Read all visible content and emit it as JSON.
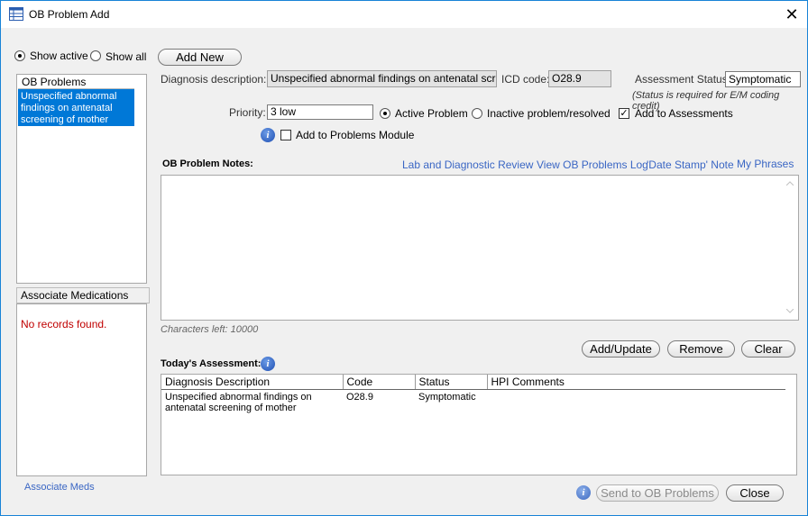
{
  "window": {
    "title": "OB Problem Add",
    "close_glyph": "✕",
    "icon": "table-icon"
  },
  "filter": {
    "show_active": "Show active",
    "show_all": "Show all",
    "selected": "show_active"
  },
  "buttons": {
    "add_new": "Add New",
    "add_update": "Add/Update",
    "remove": "Remove",
    "clear": "Clear",
    "send_to_ob": "Send to OB Problems",
    "close": "Close"
  },
  "ob_problems": {
    "header": "OB Problems",
    "items": [
      {
        "label": "Unspecified abnormal findings on antenatal screening of mother",
        "selected": true
      }
    ]
  },
  "associate_medications": {
    "header": "Associate Medications",
    "empty_text": "No records found.",
    "link": "Associate Meds"
  },
  "form": {
    "diagnosis_label": "Diagnosis description:",
    "diagnosis_value": "Unspecified abnormal findings on antenatal screening of mother",
    "icd_label": "ICD code:",
    "icd_value": "O28.9",
    "assessment_status_label": "Assessment Status:",
    "assessment_status_value": "Symptomatic",
    "status_note": "(Status is required for E/M coding credit)",
    "priority_label": "Priority:",
    "priority_value": "3 low",
    "active_problem": "Active Problem",
    "inactive_problem": "Inactive problem/resolved",
    "add_to_assessments": "Add to Assessments",
    "add_to_assessments_checked": true,
    "add_to_problems_module": "Add to Problems Module",
    "add_to_problems_module_checked": false
  },
  "notes": {
    "label": "OB Problem Notes:",
    "links": [
      "Lab and Diagnostic Review",
      "View OB Problems Log",
      "'Date Stamp' Note",
      "My Phrases"
    ],
    "characters_left": "Characters left: 10000"
  },
  "assessment": {
    "label": "Today's Assessment:",
    "columns": [
      "Diagnosis Description",
      "Code",
      "Status",
      "HPI Comments"
    ],
    "rows": [
      {
        "description": "Unspecified abnormal findings on antenatal screening of mother",
        "code": "O28.9",
        "status": "Symptomatic",
        "hpi": ""
      }
    ]
  },
  "colors": {
    "accent_border": "#1883d7",
    "selection": "#0078d7",
    "link": "#3a66c4",
    "empty_text": "#c00000"
  }
}
